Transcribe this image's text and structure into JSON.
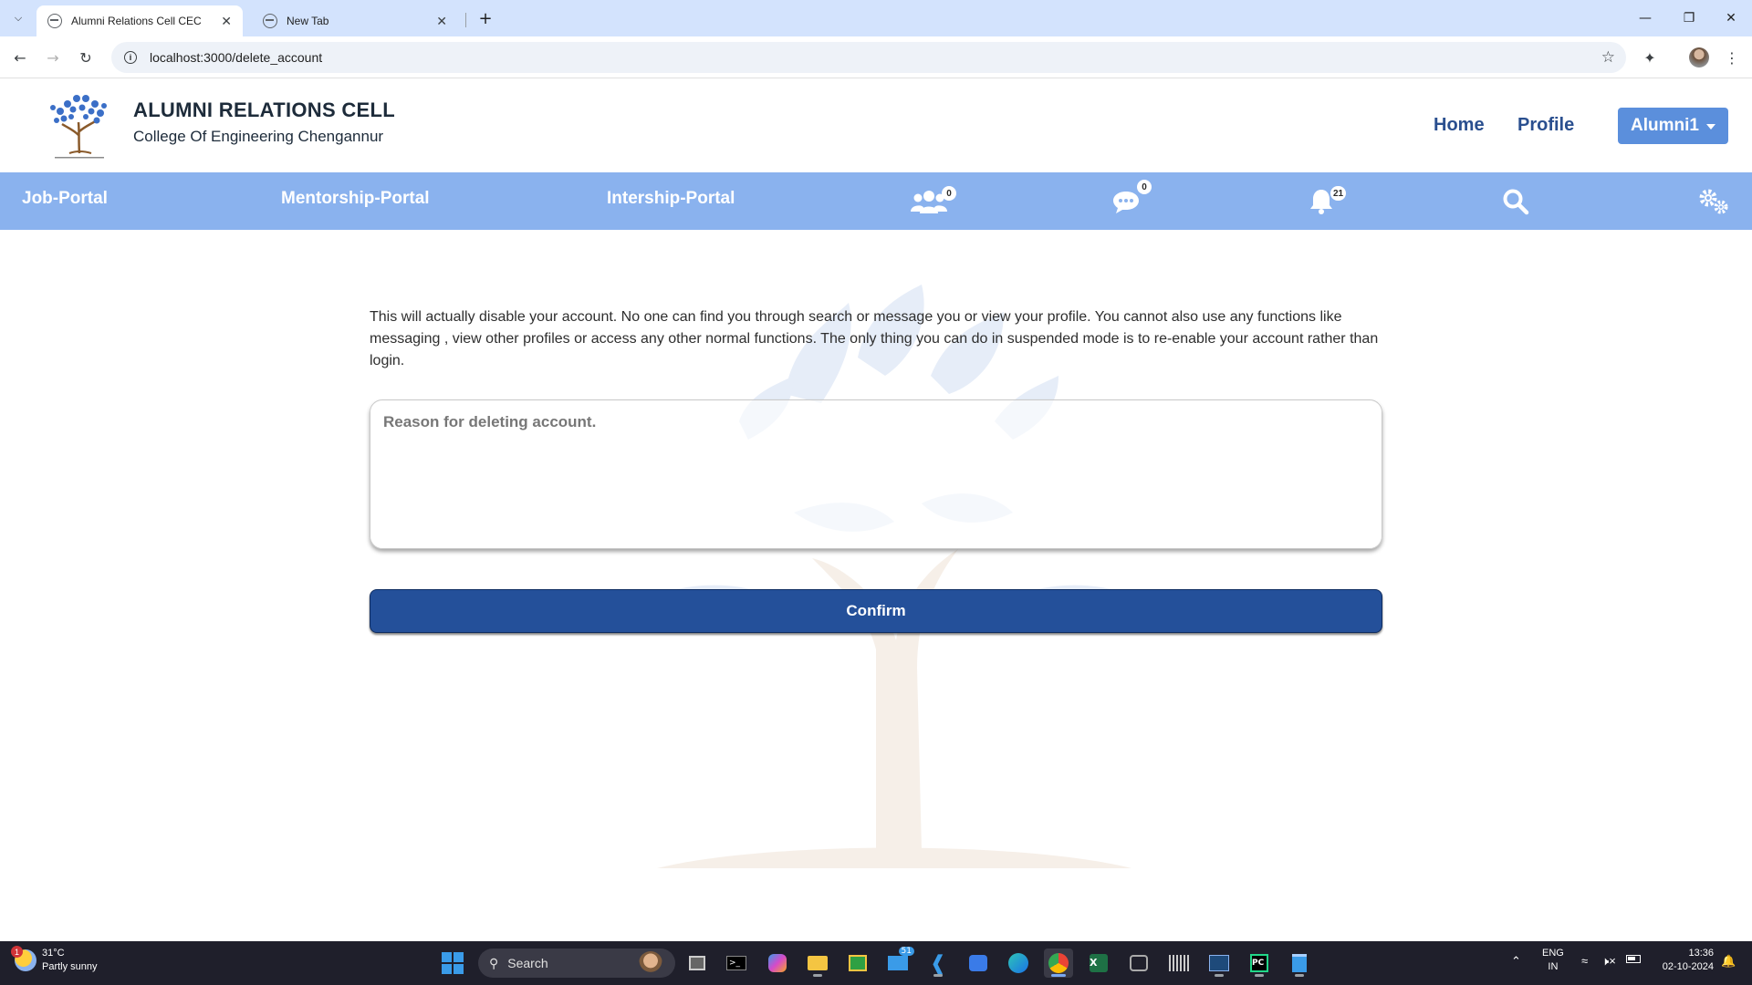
{
  "browser": {
    "tabs": [
      {
        "title": "Alumni Relations Cell CEC",
        "active": true
      },
      {
        "title": "New Tab",
        "active": false
      }
    ],
    "url": "localhost:3000/delete_account"
  },
  "site": {
    "brand_title": "ALUMNI RELATIONS CELL",
    "brand_subtitle": "College Of Engineering Chengannur",
    "header_links": {
      "home": "Home",
      "profile": "Profile"
    },
    "user_menu_label": "Alumni1"
  },
  "nav": {
    "links": [
      "Job-Portal",
      "Mentorship-Portal",
      "Intership-Portal"
    ],
    "badges": {
      "connections": "0",
      "messages": "0",
      "notifications": "21"
    },
    "colors": {
      "bar": "#8ab2ee",
      "header_button": "#5b8fdc",
      "link": "#2a4f8f"
    }
  },
  "main": {
    "notice": "This will actually disable your account. No one can find you through search or message you or view your profile. You cannot also use any functions like messaging , view other profiles or access any other normal functions. The only thing you can do in suspended mode is to re-enable your account rather than login.",
    "reason_placeholder": "Reason for deleting account.",
    "confirm_label": "Confirm",
    "confirm_color": "#24509a"
  },
  "taskbar": {
    "weather_temp": "31°C",
    "weather_desc": "Partly sunny",
    "weather_alert": "1",
    "search_label": "Search",
    "mail_badge": "51",
    "lang_line1": "ENG",
    "lang_line2": "IN",
    "time": "13:36",
    "date": "02-10-2024"
  }
}
